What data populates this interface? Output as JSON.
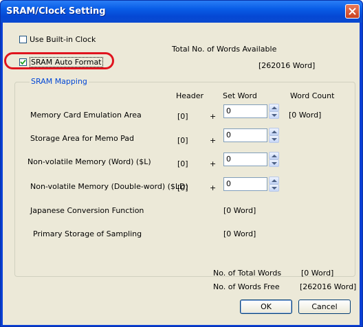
{
  "window": {
    "title": "SRAM/Clock Setting"
  },
  "options": {
    "use_builtin_clock": {
      "label": "Use Built-in Clock",
      "checked": false
    },
    "sram_auto_format": {
      "label": "SRAM Auto Format",
      "checked": true
    }
  },
  "available": {
    "label": "Total No. of Words Available",
    "value": "[262016 Word]"
  },
  "mapping": {
    "legend": "SRAM Mapping",
    "headers": {
      "header": "Header",
      "set_word": "Set Word",
      "word_count": "Word Count"
    },
    "rows": [
      {
        "label": "Memory Card Emulation Area",
        "header": "[0]",
        "plus": "+",
        "set_word": "0",
        "word_count": "[0 Word]"
      },
      {
        "label": "Storage Area for Memo Pad",
        "header": "[0]",
        "plus": "+",
        "set_word": "0"
      },
      {
        "label": "Non-volatile Memory (Word) ($L)",
        "header": "[0]",
        "plus": "+",
        "set_word": "0"
      },
      {
        "label": "Non-volatile Memory (Double-word) ($LD)",
        "header": "[0]",
        "plus": "+",
        "set_word": "0"
      },
      {
        "label": "Japanese Conversion Function",
        "value": "[0 Word]"
      },
      {
        "label": "Primary Storage of Sampling",
        "value": "[0 Word]"
      }
    ]
  },
  "totals": {
    "total_label": "No. of Total Words",
    "total_value": "[0 Word]",
    "free_label": "No. of Words Free",
    "free_value": "[262016 Word]"
  },
  "buttons": {
    "ok": "OK",
    "cancel": "Cancel"
  },
  "colors": {
    "title_bar": "#0a5fe8",
    "highlight": "#e0141e",
    "groupbox_legend": "#0046d5",
    "dialog_bg": "#ece9d8"
  }
}
